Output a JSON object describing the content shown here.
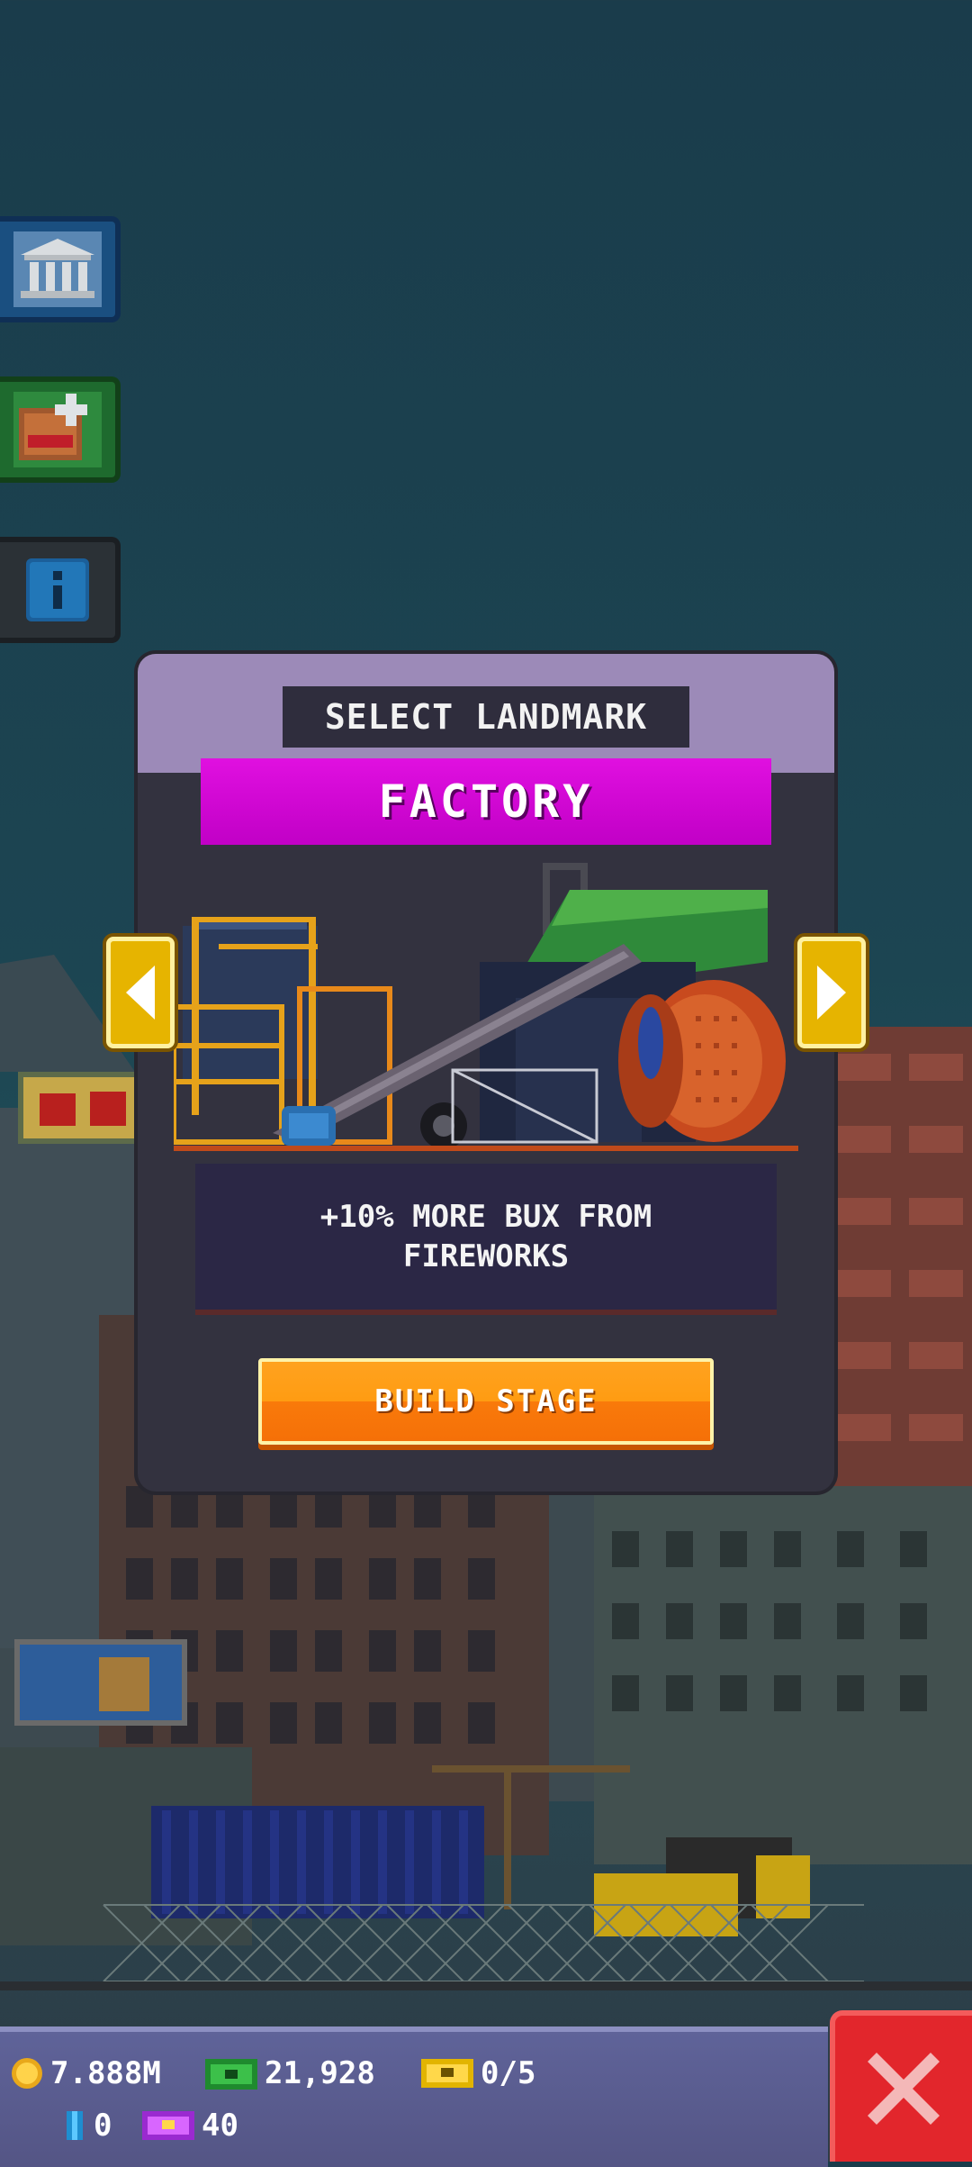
{
  "modal": {
    "title": "SELECT LANDMARK",
    "landmark_name": "FACTORY",
    "description": "+10% MORE BUX FROM FIREWORKS",
    "build_label": "BUILD STAGE"
  },
  "side_buttons": [
    {
      "icon": "museum-icon"
    },
    {
      "icon": "blueprint-add-icon"
    },
    {
      "icon": "info-icon",
      "glyph": "i"
    }
  ],
  "resources": {
    "coins": "7.888M",
    "bux": "21,928",
    "tickets": "0/5",
    "gems": "0",
    "vip": "40"
  },
  "colors": {
    "banner": "#d000d6",
    "build_button": "#ff9312",
    "close_button": "#e2262c",
    "arrow": "#e6b400"
  }
}
